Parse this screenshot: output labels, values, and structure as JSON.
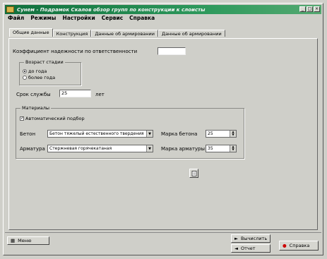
{
  "window": {
    "title": "Сунем - Подрамок Скалов обзор групп по конструкции к слоисты"
  },
  "menu": [
    "Файл",
    "Режимы",
    "Настройки",
    "Сервис",
    "Справка"
  ],
  "tabs": [
    "Общие данные",
    "Конструкция",
    "Данные об армировании",
    "Данные об армировании"
  ],
  "general": {
    "reliability_label": "Коэффициент надежности по ответственности",
    "reliability_value": "",
    "age_group_title": "Возраст стадии",
    "age_options": [
      "до года",
      "более года"
    ],
    "service_life_label": "Срок службы",
    "service_life_value": "25",
    "service_life_unit": "лет"
  },
  "materials": {
    "title": "Материалы",
    "auto_select_label": "Автоматический подбор",
    "concrete_label": "Бетон",
    "concrete_value": "Бетон тяжелый естественного твердения",
    "concrete_grade_label": "Марка бетона",
    "concrete_grade_value": "25",
    "rebar_label": "Арматура",
    "rebar_value": "Стержневая горячекатаная",
    "rebar_grade_label": "Марка арматуры",
    "rebar_grade_value": "35"
  },
  "footer": {
    "menu_button": "Меню",
    "calc_button": "Вычислить",
    "report_button": "Отчет",
    "help_button": "Справка"
  }
}
